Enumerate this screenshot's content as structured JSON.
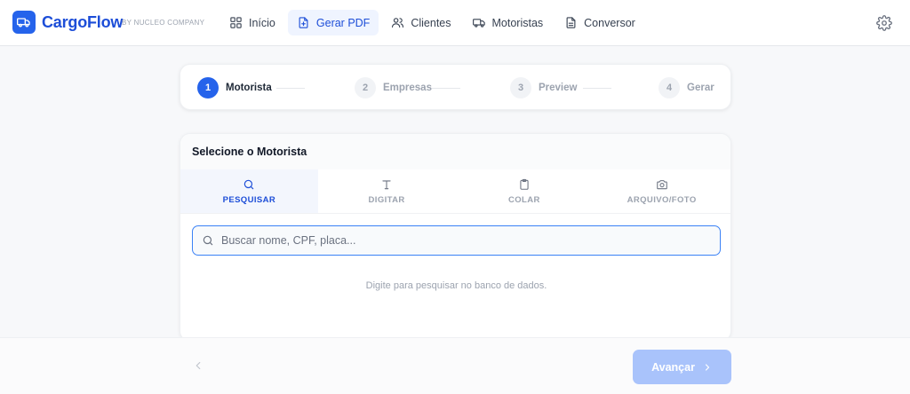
{
  "app": {
    "brand": "CargoFlow",
    "brand_sub": "BY NUCLEO COMPANY"
  },
  "nav": {
    "items": [
      {
        "label": "Início",
        "icon": "grid-icon",
        "active": false
      },
      {
        "label": "Gerar PDF",
        "icon": "file-plus-icon",
        "active": true
      },
      {
        "label": "Clientes",
        "icon": "users-icon",
        "active": false
      },
      {
        "label": "Motoristas",
        "icon": "truck-icon",
        "active": false
      },
      {
        "label": "Conversor",
        "icon": "document-icon",
        "active": false
      }
    ]
  },
  "stepper": {
    "steps": [
      {
        "num": "1",
        "label": "Motorista",
        "active": true
      },
      {
        "num": "2",
        "label": "Empresas",
        "active": false
      },
      {
        "num": "3",
        "label": "Preview",
        "active": false
      },
      {
        "num": "4",
        "label": "Gerar",
        "active": false
      }
    ]
  },
  "card": {
    "title": "Selecione o Motorista",
    "tabs": [
      {
        "label": "PESQUISAR",
        "icon": "search-icon",
        "active": true
      },
      {
        "label": "DIGITAR",
        "icon": "text-icon",
        "active": false
      },
      {
        "label": "COLAR",
        "icon": "clipboard-icon",
        "active": false
      },
      {
        "label": "ARQUIVO/FOTO",
        "icon": "camera-icon",
        "active": false
      }
    ],
    "search": {
      "value": "",
      "placeholder": "Buscar nome, CPF, placa..."
    },
    "hint": "Digite para pesquisar no banco de dados."
  },
  "footer": {
    "next_label": "Avançar"
  },
  "colors": {
    "accent": "#2563eb",
    "accent_dark": "#1d4ed8",
    "disabled_button": "#a9c3fb"
  }
}
